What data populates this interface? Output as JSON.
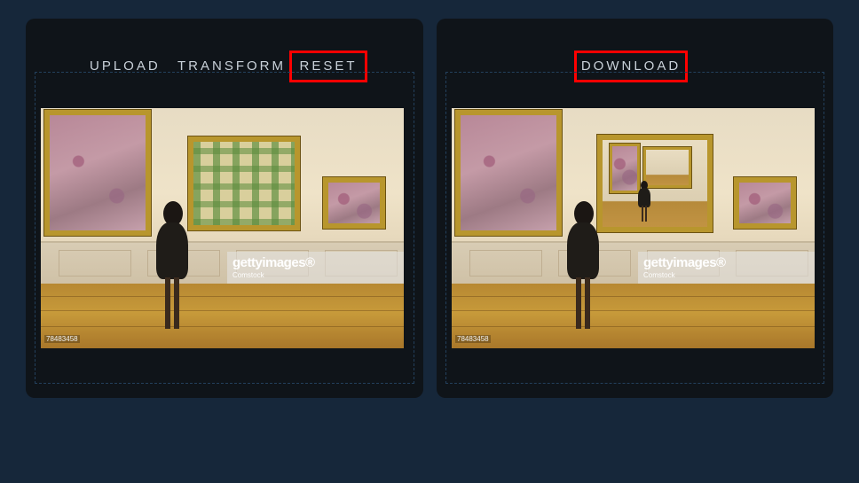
{
  "left_panel": {
    "buttons": {
      "upload_label": "UPLOAD",
      "transform_label": "TRANSFORM",
      "reset_label": "RESET"
    },
    "image": {
      "watermark_brand": "gettyimages®",
      "watermark_sub": "Comstock",
      "photo_id": "78483458"
    }
  },
  "right_panel": {
    "buttons": {
      "download_label": "DOWNLOAD"
    },
    "image": {
      "watermark_brand": "gettyimages®",
      "watermark_sub": "Comstock",
      "photo_id": "78483458"
    }
  },
  "colors": {
    "background": "#16273a",
    "panel": "#0f1419",
    "button_text": "#c9d1d9",
    "highlight": "#ff0000",
    "dropzone_border": "#23405c"
  }
}
